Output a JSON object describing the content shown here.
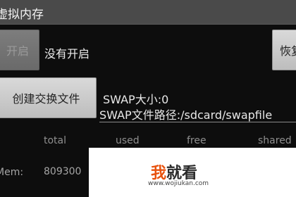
{
  "app": {
    "title": "虚拟内存"
  },
  "controls": {
    "enable_button": "开启",
    "enable_status": "没有开启",
    "restore_button": "恢复",
    "create_swap_button": "创建交换文件"
  },
  "swap": {
    "size_text": "SWAP大小:0",
    "path_text": "SWAP文件路径:/sdcard/swapfile"
  },
  "memory": {
    "columns": [
      "total",
      "used",
      "free",
      "shared"
    ],
    "row_label": "Mem:",
    "total_value": "809300"
  },
  "watermark": {
    "brand_part1": "我",
    "brand_part2": "就看",
    "url": "www.wojiukan.com",
    "colors": {
      "brand_accent": "#e8520e",
      "brand_dark": "#2a2a2a"
    }
  },
  "colors": {
    "title_bar": "#4a4a4a",
    "background": "#0d0d0d",
    "button": "#cfcfcf",
    "button_disabled": "#757575"
  }
}
